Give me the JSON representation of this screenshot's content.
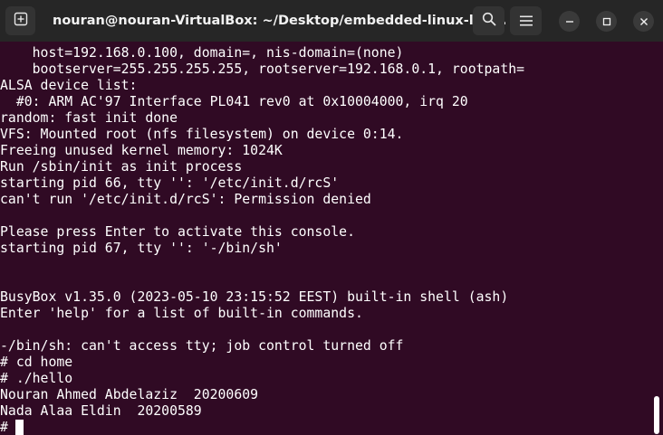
{
  "window": {
    "title": "nouran@nouran-VirtualBox: ~/Desktop/embedded-linux-lab..."
  },
  "titlebar": {
    "buttons": {
      "new_tab": "new-tab-icon",
      "search": "search-icon",
      "menu": "hamburger-menu-icon",
      "minimize": "minimize-icon",
      "maximize": "maximize-icon",
      "close": "close-icon"
    }
  },
  "colors": {
    "terminal_background": "#300a24",
    "terminal_text": "#ffffff",
    "titlebar_background": "#262626"
  },
  "terminal": {
    "lines": [
      "    host=192.168.0.100, domain=, nis-domain=(none)",
      "    bootserver=255.255.255.255, rootserver=192.168.0.1, rootpath=",
      "ALSA device list:",
      "  #0: ARM AC'97 Interface PL041 rev0 at 0x10004000, irq 20",
      "random: fast init done",
      "VFS: Mounted root (nfs filesystem) on device 0:14.",
      "Freeing unused kernel memory: 1024K",
      "Run /sbin/init as init process",
      "starting pid 66, tty '': '/etc/init.d/rcS'",
      "can't run '/etc/init.d/rcS': Permission denied",
      "",
      "Please press Enter to activate this console.",
      "starting pid 67, tty '': '-/bin/sh'",
      "",
      "",
      "BusyBox v1.35.0 (2023-05-10 23:15:52 EEST) built-in shell (ash)",
      "Enter 'help' for a list of built-in commands.",
      "",
      "-/bin/sh: can't access tty; job control turned off",
      "# cd home",
      "# ./hello",
      "Nouran Ahmed Abdelaziz  20200609",
      "Nada Alaa Eldin  20200589",
      "# "
    ]
  }
}
